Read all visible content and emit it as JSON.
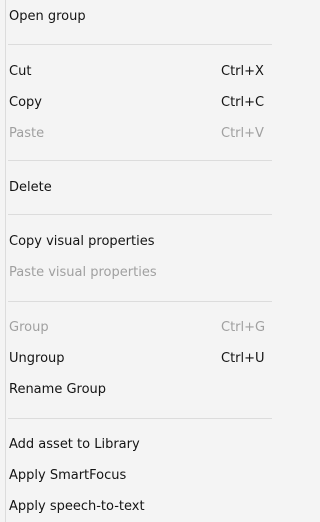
{
  "menu": {
    "open_group": {
      "label": "Open group"
    },
    "cut": {
      "label": "Cut",
      "shortcut": "Ctrl+X"
    },
    "copy": {
      "label": "Copy",
      "shortcut": "Ctrl+C"
    },
    "paste": {
      "label": "Paste",
      "shortcut": "Ctrl+V",
      "disabled": true
    },
    "delete": {
      "label": "Delete"
    },
    "copy_visual_properties": {
      "label": "Copy visual properties"
    },
    "paste_visual_properties": {
      "label": "Paste visual properties",
      "disabled": true
    },
    "group": {
      "label": "Group",
      "shortcut": "Ctrl+G",
      "disabled": true
    },
    "ungroup": {
      "label": "Ungroup",
      "shortcut": "Ctrl+U"
    },
    "rename_group": {
      "label": "Rename Group"
    },
    "add_asset_to_library": {
      "label": "Add asset to Library"
    },
    "apply_smartfocus": {
      "label": "Apply SmartFocus"
    },
    "apply_speech_to_text": {
      "label": "Apply speech-to-text"
    }
  },
  "colors": {
    "background": "#f4f4f4",
    "text": "#141414",
    "disabled_text": "#a0a0a0",
    "separator": "#dcdcdc"
  }
}
